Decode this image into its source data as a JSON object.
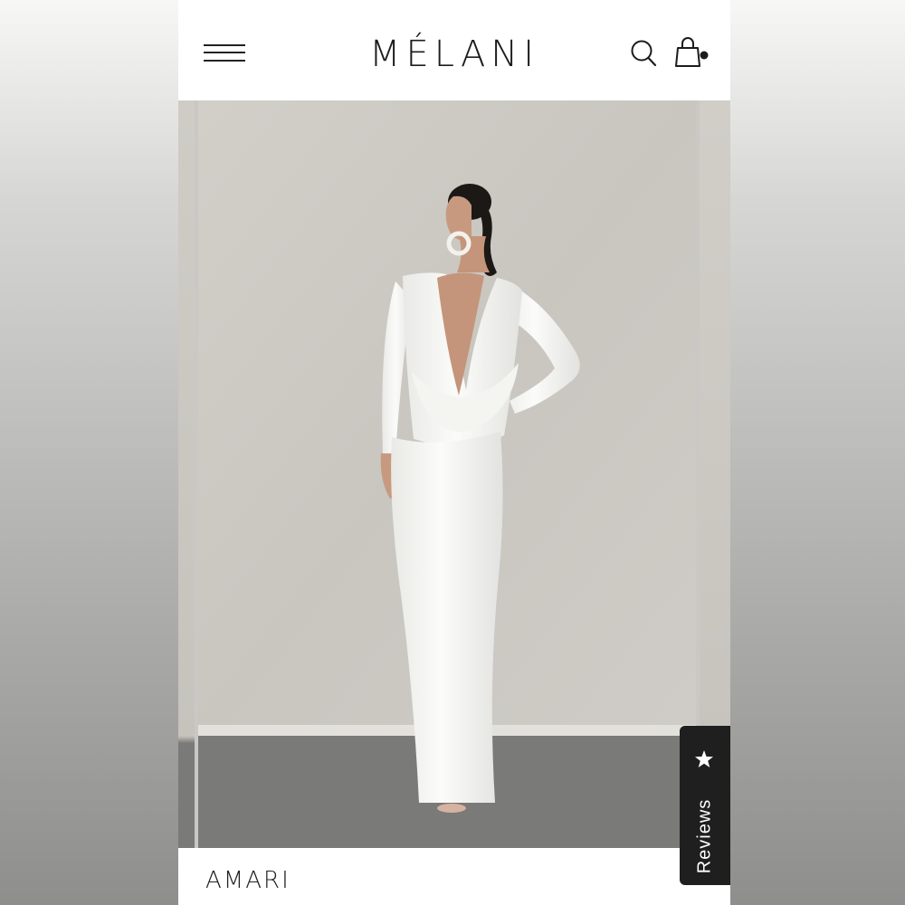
{
  "header": {
    "brand": "MÉLANI"
  },
  "icons": {
    "menu": "hamburger-menu-icon",
    "search": "search-icon",
    "bag": "shopping-bag-icon",
    "review_star": "star-icon"
  },
  "product": {
    "name": "AMARI"
  },
  "reviews_tab": {
    "label": "Reviews"
  },
  "colors": {
    "text": "#1c1c1c",
    "tab_background": "#1f1f1f",
    "wall": "#c9c8c4",
    "floor": "#7a7a78",
    "dress": "#fafaf8"
  }
}
